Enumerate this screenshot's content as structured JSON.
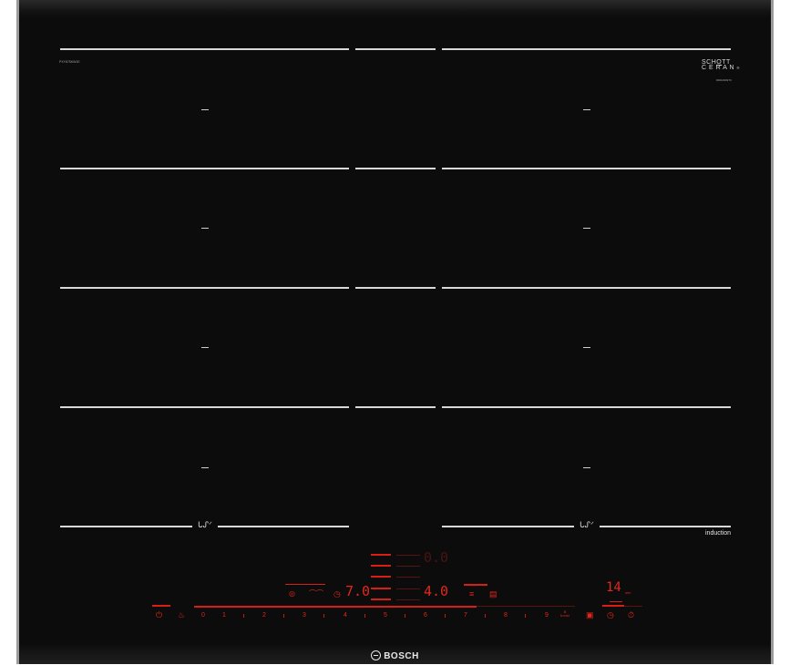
{
  "hob": {
    "model_number": "PXY875KW1E",
    "glass_brand": "SCHOTT\nCERAN",
    "glass_code": "0001000373",
    "induction_label": "induction",
    "brand": "BOSCH"
  },
  "zones": {
    "left_zone_dash_label": "–",
    "flex_icon_label": "ᒐᔑᐟ"
  },
  "controls": {
    "power_icon": "power-icon",
    "childlock_icon": "child-lock-icon",
    "slider_digits": [
      "0",
      "1",
      "2",
      "3",
      "4",
      "5",
      "6",
      "7",
      "8",
      "9"
    ],
    "boost_label": "B\nboost",
    "left_display": "7.0",
    "center_display_top": "0.0",
    "center_display_bottom": "4.0",
    "timer_display": "14",
    "timer_unit": "min",
    "accent_color": "#e2261c",
    "glass_color": "#0c0c0c",
    "line_color": "#d8d8d8"
  }
}
